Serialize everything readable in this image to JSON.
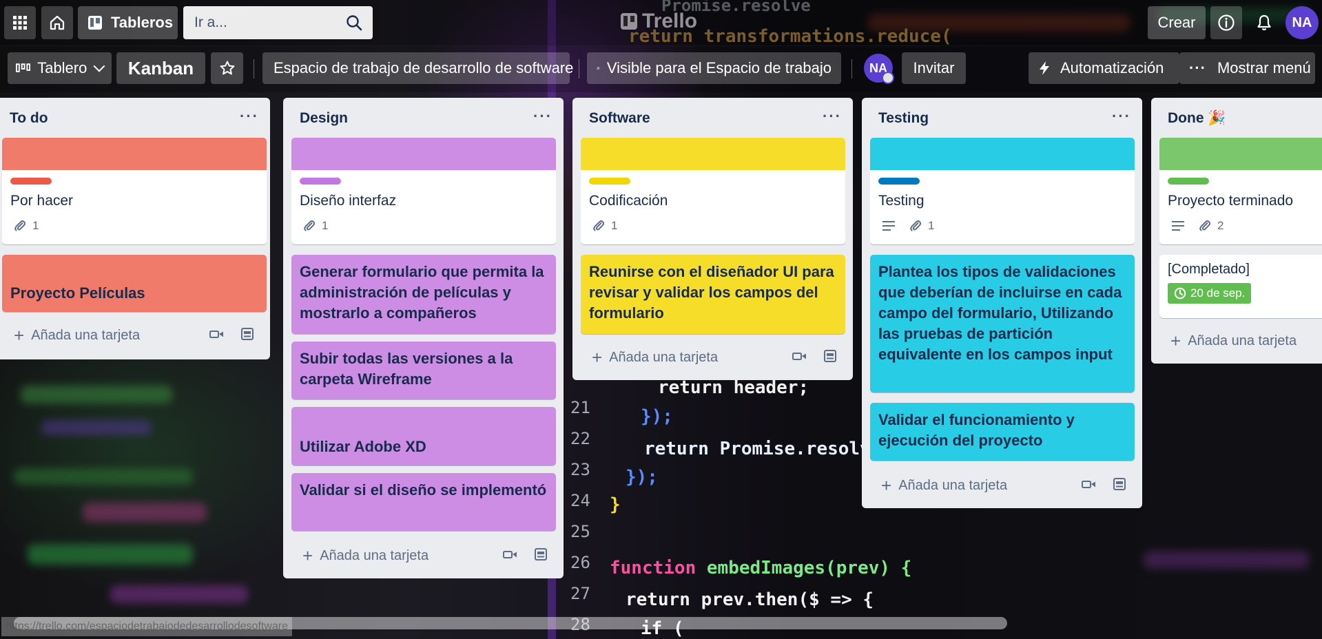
{
  "topbar": {
    "boards_label": "Tableros",
    "search_placeholder": "Ir a...",
    "logo_text": "Trello",
    "create_label": "Crear",
    "avatar_initials": "NA"
  },
  "boardbar": {
    "view_label": "Tablero",
    "board_name": "Kanban",
    "workspace_label": "Espacio de trabajo de desarrollo de software",
    "visibility_label": "Visible para el Espacio de trabajo",
    "member_initials": "NA",
    "invite_label": "Invitar",
    "automation_label": "Automatización",
    "menu_label": "Mostrar menú"
  },
  "colors": {
    "red": "#f07b6b",
    "red_label": "#eb5a46",
    "purple": "#cd8de5",
    "purple_label": "#c377e0",
    "yellow": "#f5dd29",
    "yellow_label": "#f2d600",
    "sky": "#29cce5",
    "blue_label": "#0079bf",
    "green": "#7bc86c",
    "green_label": "#61bd4f",
    "due_green": "#61bd4f"
  },
  "lists": [
    {
      "title": "To do",
      "cards": [
        {
          "title": "Por hacer",
          "attachments": "1"
        },
        {
          "title": "Proyecto Películas"
        }
      ],
      "add_label": "Añada una tarjeta"
    },
    {
      "title": "Design",
      "cards": [
        {
          "title": "Diseño interfaz",
          "attachments": "1"
        },
        {
          "title": "Generar formulario que permita la administración de películas y mostrarlo a compañeros"
        },
        {
          "title": "Subir todas las versiones a la carpeta Wireframe"
        },
        {
          "title": "Utilizar Adobe XD"
        },
        {
          "title": "Validar si el diseño se implementó"
        }
      ],
      "add_label": "Añada una tarjeta"
    },
    {
      "title": "Software",
      "cards": [
        {
          "title": "Codificación",
          "attachments": "1"
        },
        {
          "title": "Reunirse con el diseñador UI para revisar y validar los campos del formulario"
        }
      ],
      "add_label": "Añada una tarjeta"
    },
    {
      "title": "Testing",
      "cards": [
        {
          "title": "Testing",
          "attachments": "1"
        },
        {
          "title": "Plantea los tipos de validaciones que deberían de incluirse en cada campo del formulario, Utilizando las pruebas de partición equivalente en los campos input"
        },
        {
          "title": "Validar el funcionamiento y ejecución del proyecto"
        }
      ],
      "add_label": "Añada una tarjeta"
    },
    {
      "title": "Done 🎉",
      "cards": [
        {
          "title": "Proyecto terminado",
          "attachments": "2"
        },
        {
          "title": "[Completado]",
          "due": "20 de sep."
        }
      ],
      "add_label": "Añada una tarjeta"
    }
  ],
  "status_url": "https://trello.com/espaciodetrabajodedesarrollodesoftware",
  "background_code": {
    "line1": "Promise.resolve",
    "line2": "return transformations.reduce(",
    "line3": "return header;",
    "line4": "});",
    "line5": "return Promise.resolve(",
    "line6": "});",
    "line7": "}",
    "line8_kw": "function",
    "line8_rest": "embedImages(prev) {",
    "line9": "return prev.then($ => {",
    "line10": "if (",
    "numbers": [
      "21",
      "22",
      "23",
      "24",
      "25",
      "26",
      "27",
      "28"
    ]
  }
}
